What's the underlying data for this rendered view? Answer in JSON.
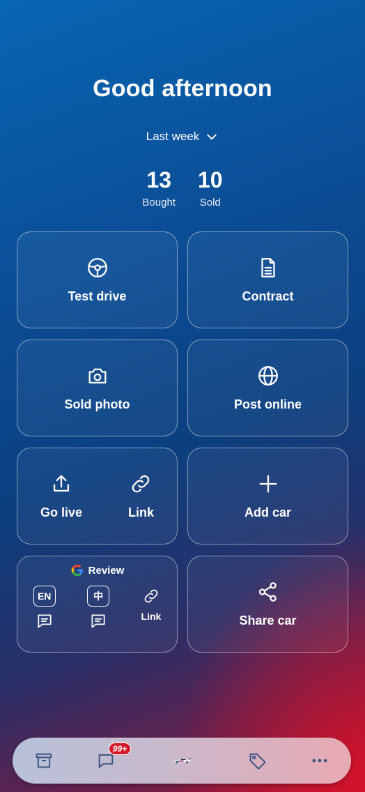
{
  "greeting": "Good afternoon",
  "period": {
    "label": "Last week"
  },
  "stats": [
    {
      "value": "13",
      "label": "Bought"
    },
    {
      "value": "10",
      "label": "Sold"
    }
  ],
  "tiles": {
    "test_drive": "Test drive",
    "contract": "Contract",
    "sold_photo": "Sold photo",
    "post_online": "Post online",
    "go_live": "Go live",
    "link": "Link",
    "add_car": "Add car",
    "review": {
      "title": "Review",
      "en": "EN",
      "zh": "中",
      "link": "Link"
    },
    "share_car": "Share car"
  },
  "tabbar": {
    "messages_badge": "99+"
  },
  "colors": {
    "bg_top": "#0766b3",
    "bg_bottom": "#d6122a",
    "badge": "#d21a2a",
    "tab_icon": "#3d5480"
  }
}
